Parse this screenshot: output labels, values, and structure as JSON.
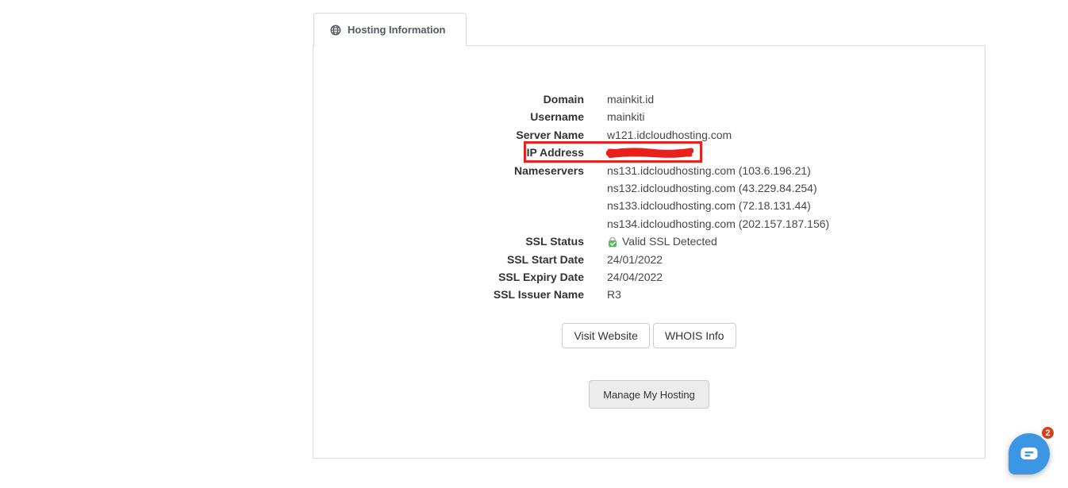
{
  "tab": {
    "label": "Hosting Information",
    "icon": "globe-icon"
  },
  "panel": {
    "rows": [
      {
        "label": "Domain",
        "value": "mainkit.id"
      },
      {
        "label": "Username",
        "value": "mainkiti"
      },
      {
        "label": "Server Name",
        "value": "w121.idcloudhosting.com"
      },
      {
        "label": "IP Address",
        "value": "",
        "redacted": true
      },
      {
        "label": "Nameservers",
        "values": [
          "ns131.idcloudhosting.com (103.6.196.21)",
          "ns132.idcloudhosting.com (43.229.84.254)",
          "ns133.idcloudhosting.com (72.18.131.44)",
          "ns134.idcloudhosting.com (202.157.187.156)"
        ]
      },
      {
        "label": "SSL Status",
        "value": "Valid SSL Detected",
        "icon": "lock-check-icon"
      },
      {
        "label": "SSL Start Date",
        "value": "24/01/2022"
      },
      {
        "label": "SSL Expiry Date",
        "value": "24/04/2022"
      },
      {
        "label": "SSL Issuer Name",
        "value": "R3"
      }
    ],
    "buttons": {
      "visit_website": "Visit Website",
      "whois_info": "WHOIS Info",
      "manage_hosting": "Manage My Hosting"
    }
  },
  "chat": {
    "badge_count": "2",
    "icon": "chat-bubble-icon"
  },
  "colors": {
    "redaction_red": "#e8211d",
    "chat_blue": "#3b97e3",
    "badge_red": "#e03c17",
    "ssl_green": "#5cb85c",
    "panel_border": "#d9d9d9"
  }
}
